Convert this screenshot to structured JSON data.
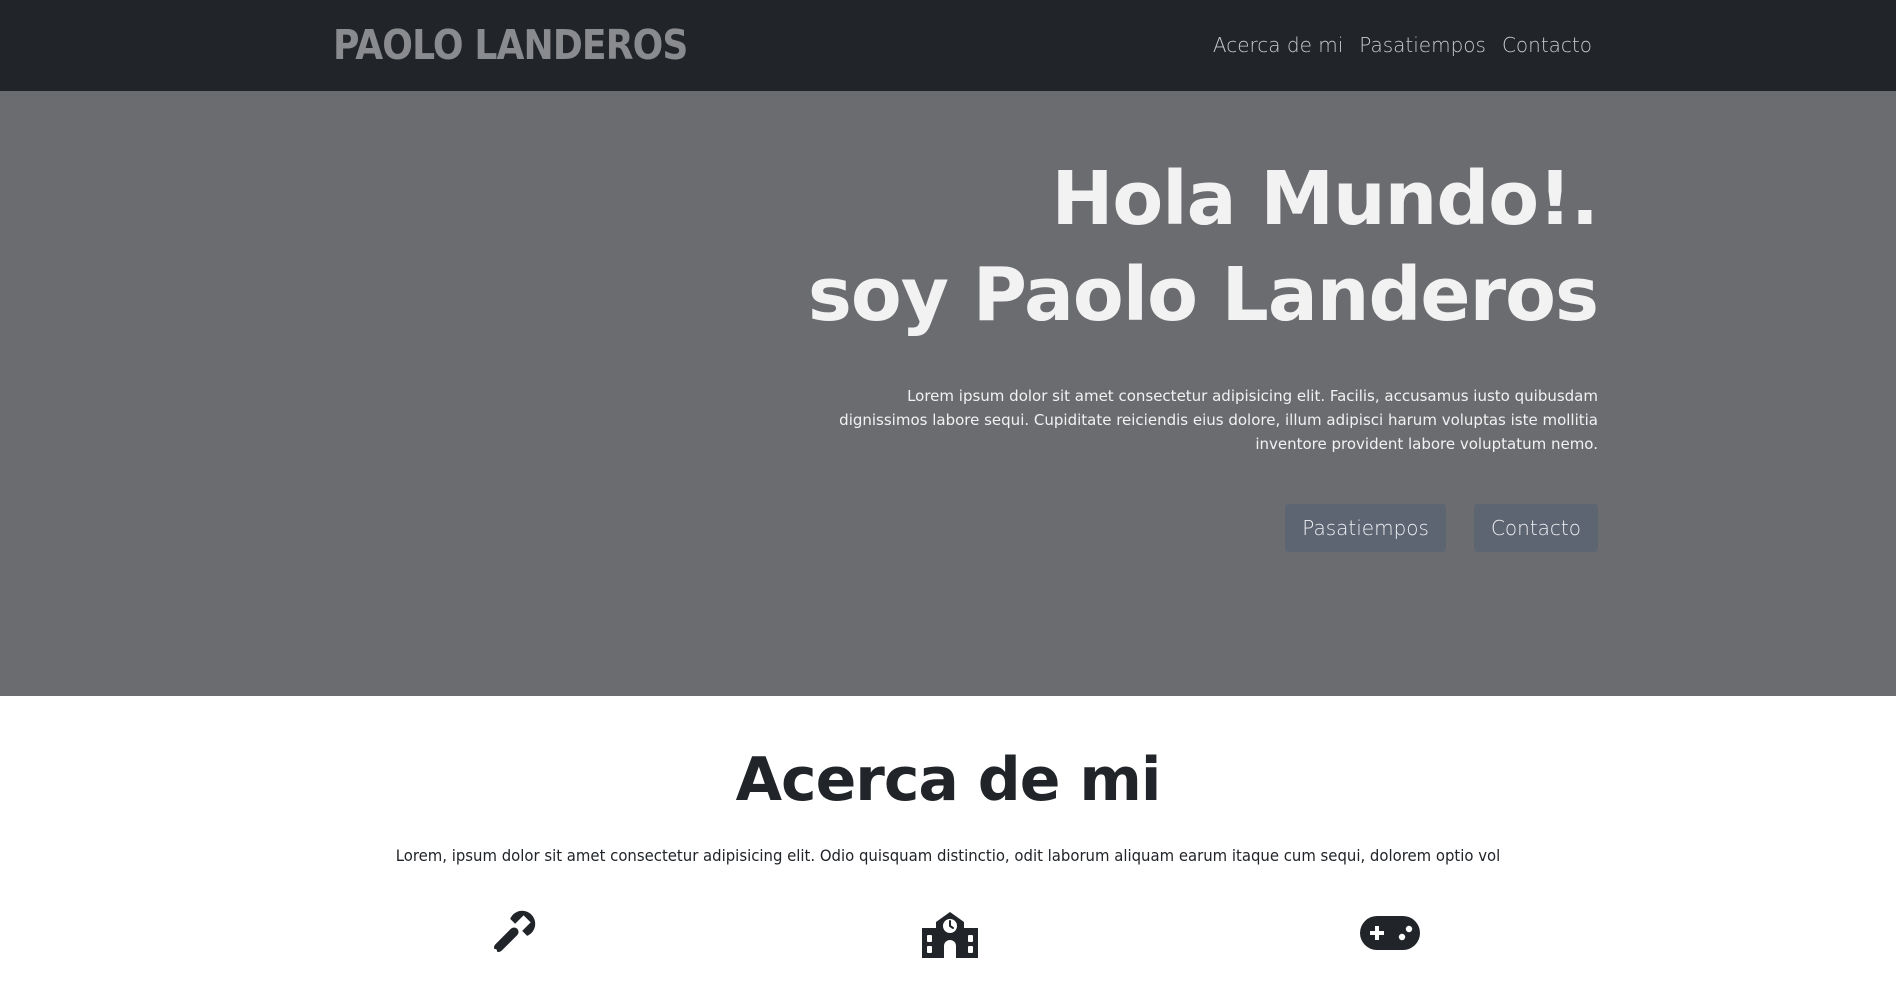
{
  "navbar": {
    "brand": "PAOLO LANDEROS",
    "links": [
      "Acerca de mi",
      "Pasatiempos",
      "Contacto"
    ]
  },
  "hero": {
    "title_line1": "Hola Mundo!.",
    "title_line2": "soy Paolo Landeros",
    "text": "Lorem ipsum dolor sit amet consectetur adipisicing elit. Facilis, accusamus iusto quibusdam dignissimos labore sequi. Cupiditate reiciendis eius dolore, illum adipisci harum voluptas iste mollitia inventore provident labore voluptatum nemo.",
    "buttons": [
      "Pasatiempos",
      "Contacto"
    ]
  },
  "about": {
    "title": "Acerca de mi",
    "text": "Lorem, ipsum dolor sit amet consectetur adipisicing elit. Odio quisquam distinctio, odit laborum aliquam earum itaque cum sequi, dolorem optio vol",
    "icons": [
      "wrench-icon",
      "school-icon",
      "gamepad-icon"
    ]
  },
  "colors": {
    "navbar_bg": "#212529",
    "hero_bg": "#6b6c6f",
    "button_bg": "#5d6472",
    "text_dark": "#212529"
  }
}
